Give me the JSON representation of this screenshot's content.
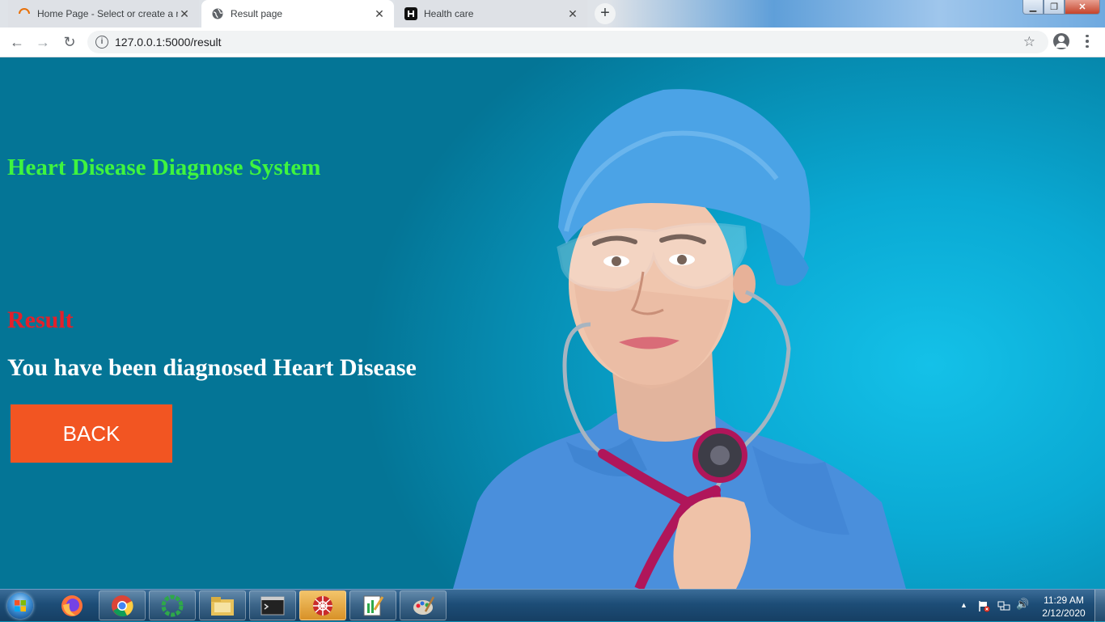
{
  "browser": {
    "tabs": [
      {
        "title": "Home Page - Select or create a n",
        "close": "✕",
        "active": false
      },
      {
        "title": "Result page",
        "close": "✕",
        "active": true
      },
      {
        "title": "Health care",
        "close": "✕",
        "active": false
      }
    ],
    "new_tab": "+",
    "window_controls": {
      "minimize": "▁",
      "maximize": "❐",
      "close": "✕"
    },
    "nav": {
      "back": "←",
      "forward": "→",
      "reload": "↻"
    },
    "address": {
      "info": "i",
      "url": "127.0.0.1:5000/result",
      "bookmark": "☆"
    }
  },
  "page": {
    "title": "Heart Disease Diagnose System",
    "result_heading": "Result",
    "diagnosis": "You have been diagnosed Heart Disease",
    "back_button": "BACK",
    "colors": {
      "title": "#3ff43f",
      "result": "#e3202a",
      "button": "#f25522",
      "background": "#0aa9d3"
    }
  },
  "taskbar": {
    "apps": [
      "firefox-icon",
      "chrome-icon",
      "progress-app-icon",
      "file-explorer-icon",
      "terminal-icon",
      "web-app-icon",
      "text-editor-icon",
      "paint-icon"
    ],
    "tray": {
      "show_hidden": "▲",
      "volume": "🔊"
    },
    "clock": {
      "time": "11:29 AM",
      "date": "2/12/2020"
    }
  }
}
